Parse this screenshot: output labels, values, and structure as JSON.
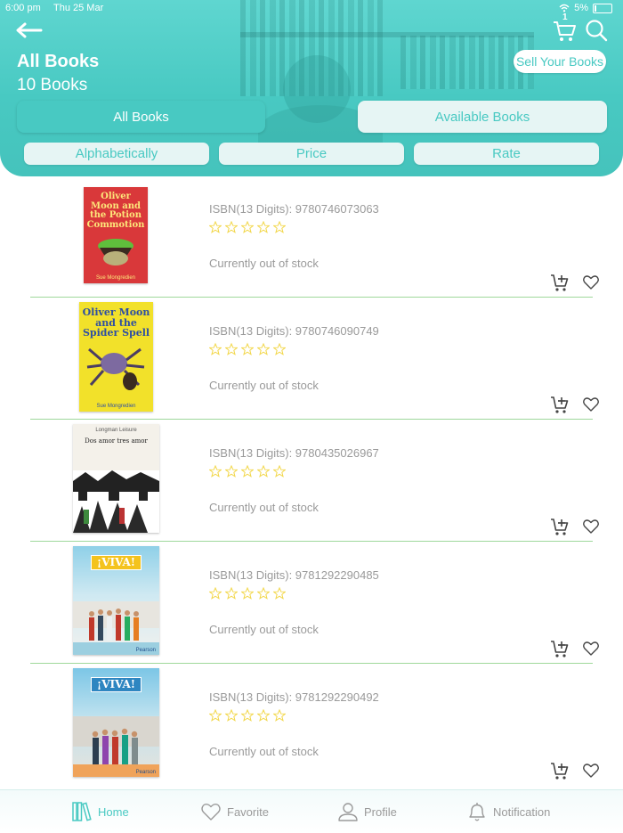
{
  "status_bar": {
    "time": "6:00 pm",
    "date": "Thu 25 Mar",
    "battery": "5%"
  },
  "header": {
    "title": "All Books",
    "count": "10 Books",
    "sell_button": "Sell Your Books",
    "cart_badge": "1",
    "tabs": [
      {
        "label": "All Books",
        "active": true
      },
      {
        "label": "Available Books",
        "active": false
      }
    ],
    "sort_options": [
      "Alphabetically",
      "Price",
      "Rate"
    ]
  },
  "books": [
    {
      "cover_title": "Oliver Moon and the Potion Commotion",
      "cover_author": "Sue Mongredien",
      "isbn": "ISBN(13 Digits): 9780746073063",
      "rating": 0,
      "stock": "Currently out of stock"
    },
    {
      "cover_title": "Oliver Moon and the Spider Spell",
      "cover_author": "Sue Mongredien",
      "isbn": "ISBN(13 Digits): 9780746090749",
      "rating": 0,
      "stock": "Currently out of stock"
    },
    {
      "cover_title": "Dos amor tres amor",
      "cover_author": "Longman Leisure",
      "isbn": "ISBN(13 Digits): 9780435026967",
      "rating": 0,
      "stock": "Currently out of stock"
    },
    {
      "cover_title": "¡VIVA!",
      "cover_author": "Pearson",
      "isbn": "ISBN(13 Digits): 9781292290485",
      "rating": 0,
      "stock": "Currently out of stock"
    },
    {
      "cover_title": "¡VIVA!",
      "cover_author": "Pearson",
      "isbn": "ISBN(13 Digits): 9781292290492",
      "rating": 0,
      "stock": "Currently out of stock"
    }
  ],
  "bottom_nav": [
    {
      "label": "Home",
      "icon": "books-icon",
      "active": true
    },
    {
      "label": "Favorite",
      "icon": "heart-icon",
      "active": false
    },
    {
      "label": "Profile",
      "icon": "user-icon",
      "active": false
    },
    {
      "label": "Notification",
      "icon": "bell-icon",
      "active": false
    }
  ],
  "colors": {
    "accent": "#48c9c2",
    "divider": "#9fd89b",
    "star": "#f2d74a"
  }
}
